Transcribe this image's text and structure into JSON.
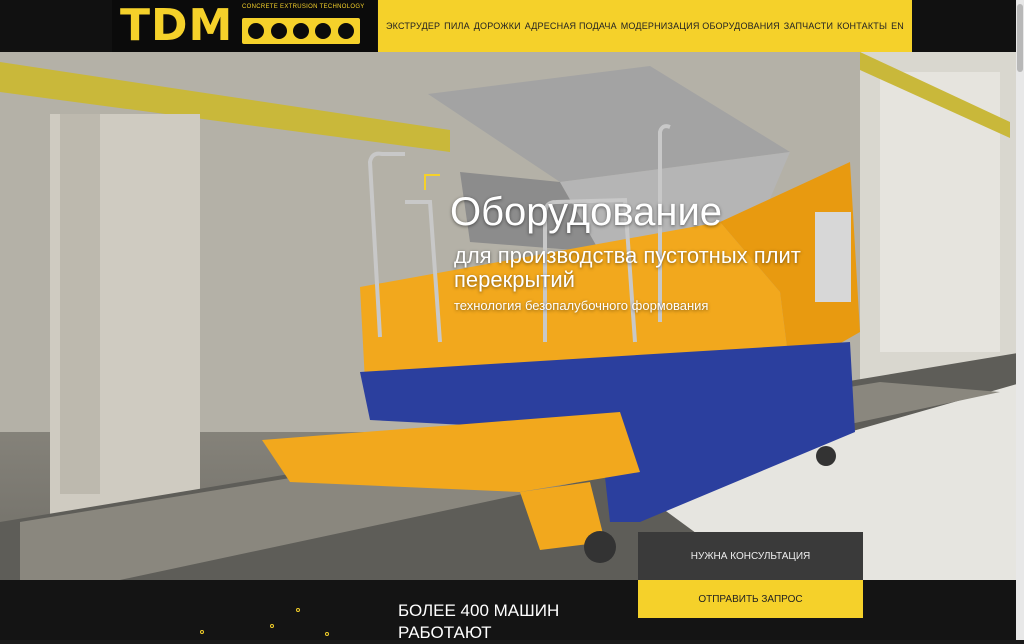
{
  "brand": {
    "logo": "TDM",
    "tagline": "CONCRETE EXTRUSION TECHNOLOGY"
  },
  "nav": [
    {
      "label": "ЭКСТРУДЕР"
    },
    {
      "label": "ПИЛА"
    },
    {
      "label": "ДОРОЖКИ"
    },
    {
      "label": "АДРЕСНАЯ ПОДАЧА"
    },
    {
      "label": "МОДЕРНИЗАЦИЯ ОБОРУДОВАНИЯ"
    },
    {
      "label": "ЗАПЧАСТИ"
    },
    {
      "label": "КОНТАКТЫ"
    },
    {
      "label": "EN"
    }
  ],
  "hero": {
    "title": "Оборудование",
    "subtitle": "для производства пустотных плит перекрытий",
    "tagline": "технология безопалубочного формования"
  },
  "cta": {
    "consult": "НУЖНА КОНСУЛЬТАЦИЯ",
    "request": "ОТПРАВИТЬ ЗАПРОС"
  },
  "stats": {
    "title": "БОЛЕЕ 400 МАШИН РАБОТАЮТ"
  },
  "colors": {
    "accent": "#f5d12a",
    "header_bg": "#111111",
    "machine_yellow": "#f2a81d",
    "frame_blue": "#2b3f9e"
  }
}
